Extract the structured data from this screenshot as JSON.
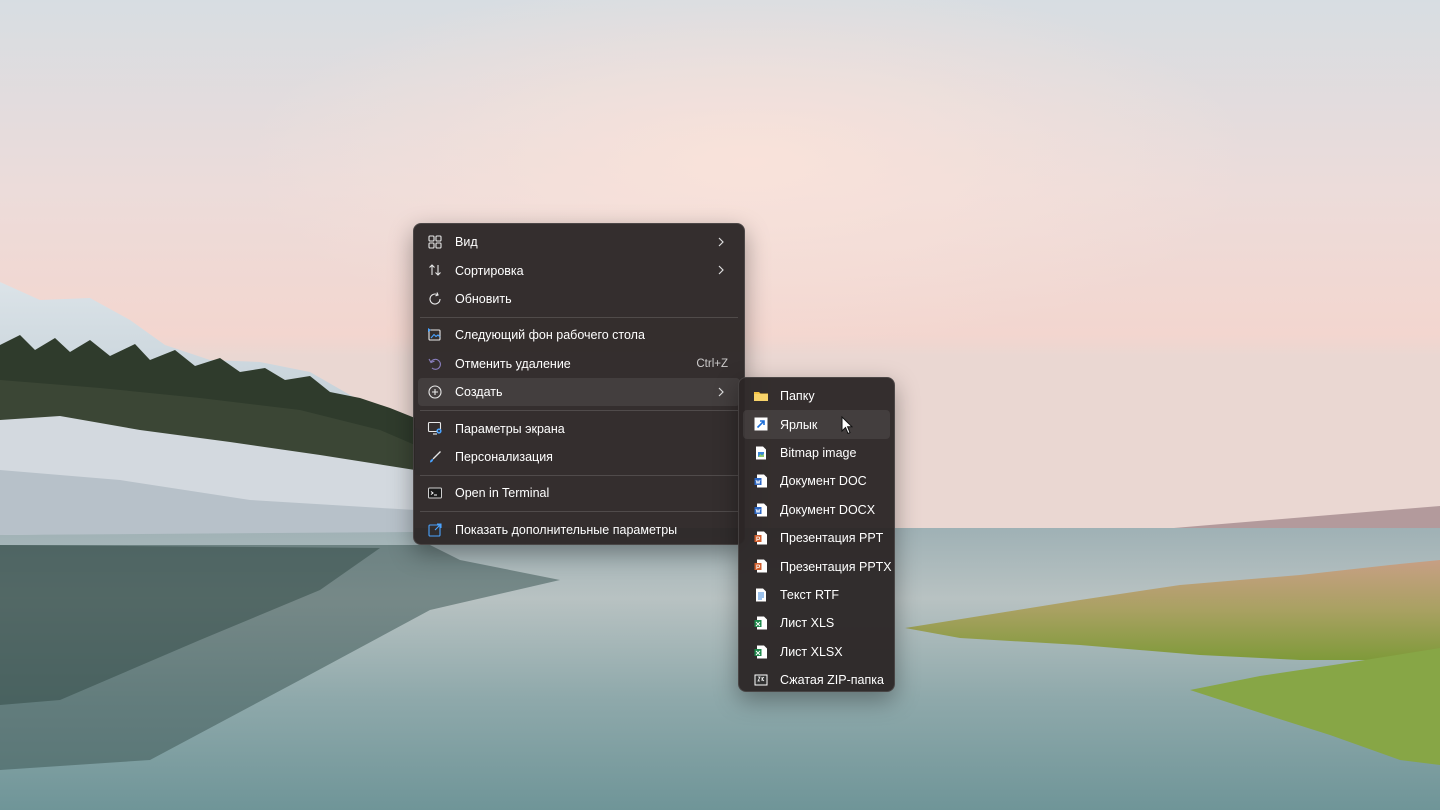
{
  "colors": {
    "menu_bg": "#2c2626",
    "menu_text": "#ffffff",
    "accent_blue": "#4aa3ff",
    "folder_yellow": "#f3c244"
  },
  "context_menu": {
    "items": [
      {
        "label": "Вид",
        "icon": "grid-view-icon",
        "has_submenu": true
      },
      {
        "label": "Сортировка",
        "icon": "sort-icon",
        "has_submenu": true
      },
      {
        "label": "Обновить",
        "icon": "refresh-icon",
        "has_submenu": false
      },
      {
        "label": "Следующий фон рабочего стола",
        "icon": "next-background-icon",
        "has_submenu": false
      },
      {
        "label": "Отменить удаление",
        "icon": "undo-icon",
        "shortcut": "Ctrl+Z",
        "has_submenu": false
      },
      {
        "label": "Создать",
        "icon": "new-icon",
        "has_submenu": true,
        "highlighted": true
      },
      {
        "label": "Параметры экрана",
        "icon": "display-settings-icon",
        "has_submenu": false
      },
      {
        "label": "Персонализация",
        "icon": "personalize-brush-icon",
        "has_submenu": false
      },
      {
        "label": "Open in Terminal",
        "icon": "terminal-icon",
        "has_submenu": false
      },
      {
        "label": "Показать дополнительные параметры",
        "icon": "more-options-icon",
        "has_submenu": false
      }
    ]
  },
  "create_submenu": {
    "items": [
      {
        "label": "Папку",
        "icon": "folder-icon"
      },
      {
        "label": "Ярлык",
        "icon": "shortcut-icon",
        "hovered": true
      },
      {
        "label": "Bitmap image",
        "icon": "bitmap-file-icon"
      },
      {
        "label": "Документ DOC",
        "icon": "word-doc-icon"
      },
      {
        "label": "Документ DOCX",
        "icon": "word-docx-icon"
      },
      {
        "label": "Презентация PPT",
        "icon": "powerpoint-ppt-icon"
      },
      {
        "label": "Презентация PPTX",
        "icon": "powerpoint-pptx-icon"
      },
      {
        "label": "Текст RTF",
        "icon": "rtf-file-icon"
      },
      {
        "label": "Лист XLS",
        "icon": "excel-xls-icon"
      },
      {
        "label": "Лист XLSX",
        "icon": "excel-xlsx-icon"
      },
      {
        "label": "Сжатая ZIP-папка",
        "icon": "zip-folder-icon"
      }
    ]
  }
}
